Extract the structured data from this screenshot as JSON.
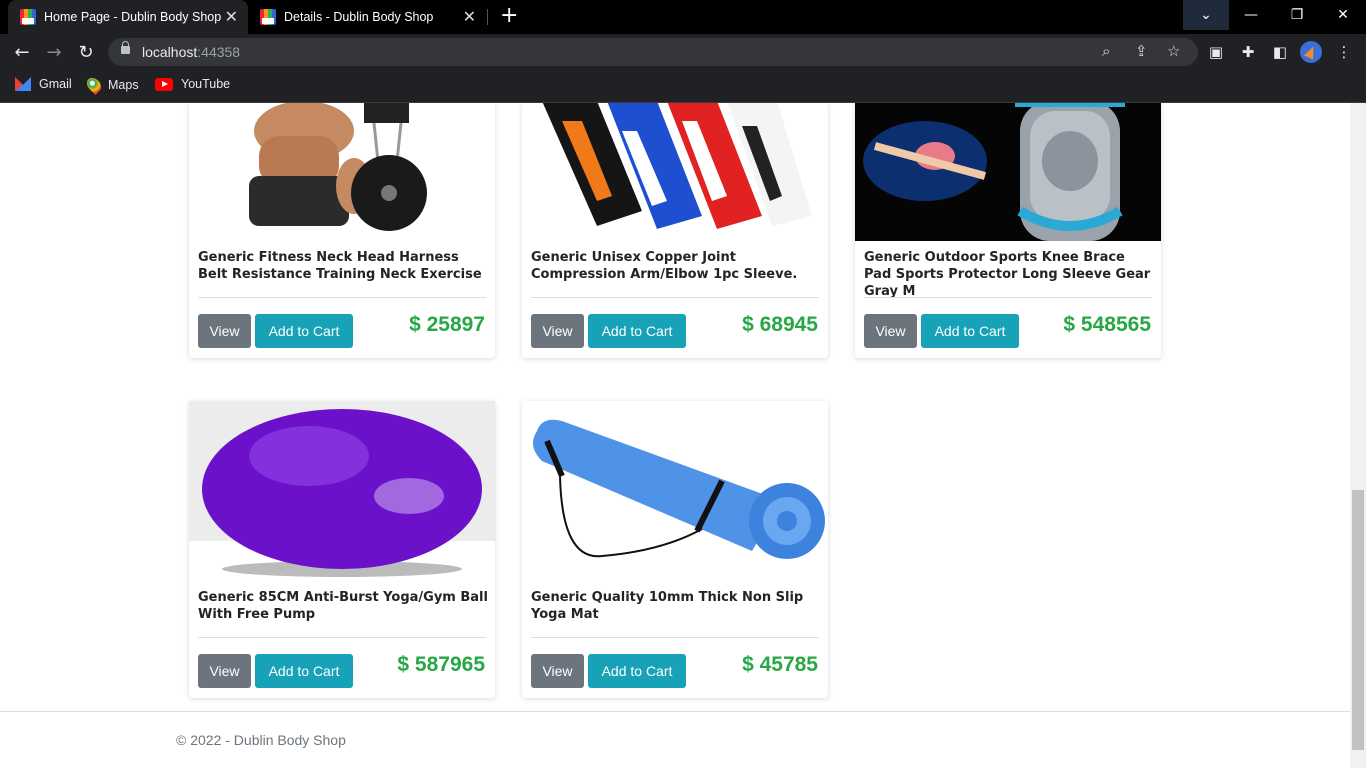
{
  "browser": {
    "tabs": [
      {
        "title": "Home Page - Dublin Body Shop",
        "active": true
      },
      {
        "title": "Details - Dublin Body Shop",
        "active": false
      }
    ],
    "url_host": "localhost",
    "url_port": ":44358",
    "bookmarks": [
      {
        "label": "Gmail",
        "icon": "gmail-icon"
      },
      {
        "label": "Maps",
        "icon": "maps-icon"
      },
      {
        "label": "YouTube",
        "icon": "youtube-icon"
      }
    ]
  },
  "products": [
    {
      "title": "Generic Fitness Neck Head Harness Belt Resistance Training Neck Exercise",
      "price": "$ 25897",
      "image": "neck-harness-image"
    },
    {
      "title": "Generic Unisex Copper Joint Compression Arm/Elbow 1pc Sleeve.",
      "price": "$ 68945",
      "image": "arm-sleeves-image"
    },
    {
      "title": "Generic Outdoor Sports Knee Brace Pad Sports Protector Long Sleeve Gear Gray M",
      "price": "$ 548565",
      "image": "knee-brace-image"
    },
    {
      "title": "Generic 85CM Anti-Burst Yoga/Gym Ball With Free Pump",
      "price": "$ 587965",
      "image": "gym-ball-image"
    },
    {
      "title": "Generic Quality 10mm Thick Non Slip Yoga Mat",
      "price": "$ 45785",
      "image": "yoga-mat-image"
    }
  ],
  "buttons": {
    "view": "View",
    "add_to_cart": "Add to Cart"
  },
  "footer": {
    "text": "© 2022 - Dublin Body Shop"
  },
  "colors": {
    "view_btn": "#6c757d",
    "cart_btn": "#17a2b8",
    "price": "#28a745"
  }
}
